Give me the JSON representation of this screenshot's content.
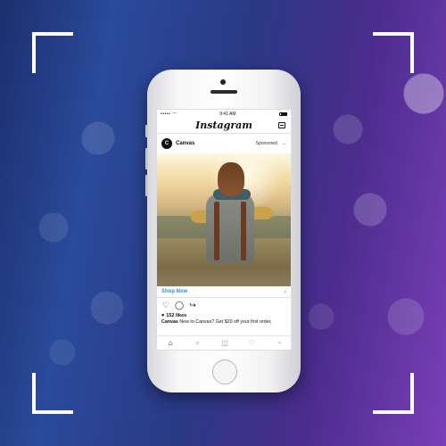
{
  "status_bar": {
    "signal": "•••••",
    "time": "9:41 AM"
  },
  "app": {
    "name": "Instagram"
  },
  "post": {
    "avatar_letter": "C",
    "username": "Canvas",
    "sponsored_label": "Sponsored",
    "shop_now_label": "Shop Now",
    "likes_text": "152 likes",
    "caption_user": "Canvas",
    "caption_text": "New to Canvas? Get $20 off your first order,"
  },
  "icons": {
    "like": "heart-icon",
    "comment": "comment-icon",
    "share": "share-icon",
    "home": "home-icon",
    "search": "search-icon",
    "camera": "camera-icon",
    "activity": "heart-icon",
    "profile": "profile-icon",
    "inbox": "inbox-icon"
  },
  "colors": {
    "accent": "#2d8fe0",
    "frame": "#ffffff"
  }
}
